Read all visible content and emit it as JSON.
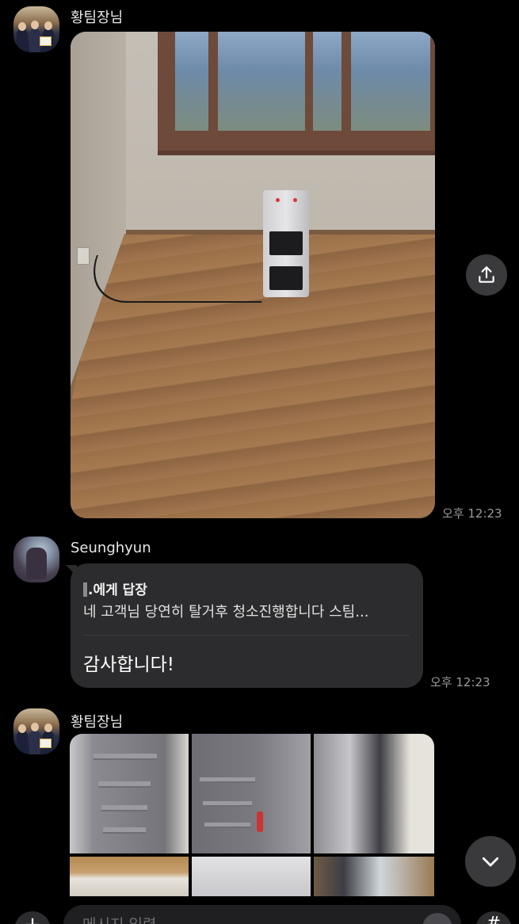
{
  "messages": [
    {
      "sender": "황팀장님",
      "time": "오후 12:23",
      "content": "photo"
    },
    {
      "sender": "Seunghyun",
      "time": "오후 12:23",
      "reply_to": ".에게 답장",
      "quoted_text": "네 고객님 당연히 탈거후 청소진행합니다 스팀...",
      "text": "감사합니다!"
    },
    {
      "sender": "황팀장님",
      "content": "photo-grid",
      "photo_count_visible": 6
    }
  ],
  "composer": {
    "placeholder": "메시지 입력",
    "plus_label": "+",
    "hash_label": "#"
  },
  "icons": {
    "share": "share-upload-icon",
    "scroll_down": "chevron-down-icon",
    "emoji": "emoji-icon"
  },
  "colors": {
    "background": "#000000",
    "bubble": "#2c2c2e",
    "timestamp": "#9a9a9a",
    "button": "#3a3a3c"
  }
}
